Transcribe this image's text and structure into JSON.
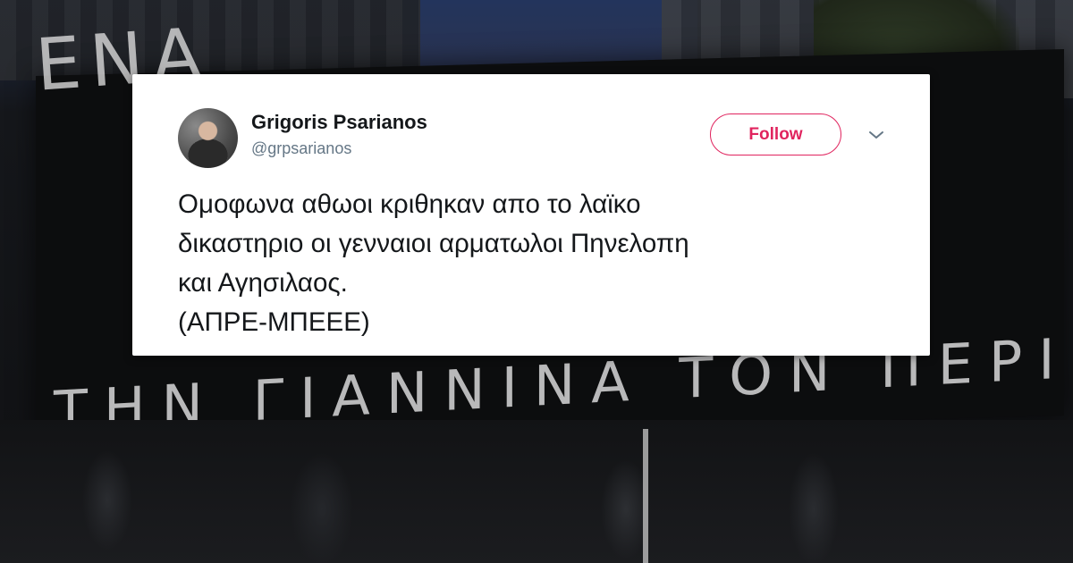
{
  "tweet": {
    "author_name": "Grigoris Psarianos",
    "author_handle": "@grpsarianos",
    "follow_label": "Follow",
    "text": "Ομοφωνα αθωοι κριθηκαν απο το λαϊκο\nδικαστηριο οι γενναιοι αρματωλοι Πηνελοπη\nκαι Αγησιλαος.\n(ΑΠΡΕ-ΜΠΕΕΕ)",
    "accent_color": "#e0245e",
    "menu_icon": "chevron-down-icon",
    "avatar_icon": "profile-photo"
  },
  "background": {
    "banner_text_top": "ΕΝΑ",
    "banner_text_bottom": "ΤΗΝ ΓΙΑΝΝΙΝΑ ΤΟΝ ΠΕΡΙΚΛΗ"
  }
}
